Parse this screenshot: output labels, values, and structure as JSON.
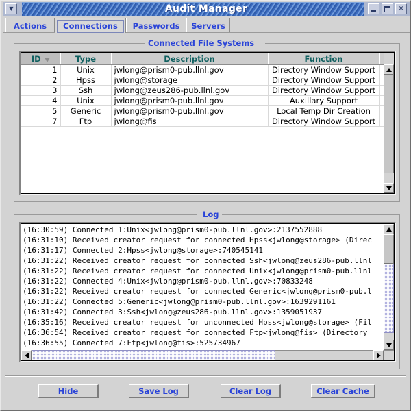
{
  "window": {
    "title": "Audit Manager",
    "menu_icon": "chevron-down-icon",
    "minimize_label": "–",
    "maximize_label": "□",
    "close_label": "✕"
  },
  "tabs": [
    {
      "label": "Actions",
      "selected": false
    },
    {
      "label": "Connections",
      "selected": true
    },
    {
      "label": "Passwords",
      "selected": false
    },
    {
      "label": "Servers",
      "selected": false
    }
  ],
  "connected_panel": {
    "title": "Connected File Systems",
    "columns": [
      "ID",
      "Type",
      "Description",
      "Function",
      ""
    ],
    "sort_column": "ID",
    "sort_direction": "descending",
    "rows": [
      {
        "id": "1",
        "type": "Unix",
        "description": "jwlong@prism0-pub.llnl.gov",
        "function": "Directory Window Support"
      },
      {
        "id": "2",
        "type": "Hpss",
        "description": "jwlong@storage",
        "function": "Directory Window Support"
      },
      {
        "id": "3",
        "type": "Ssh",
        "description": "jwlong@zeus286-pub.llnl.gov",
        "function": "Directory Window Support"
      },
      {
        "id": "4",
        "type": "Unix",
        "description": "jwlong@prism0-pub.llnl.gov",
        "function": "Auxillary Support"
      },
      {
        "id": "5",
        "type": "Generic",
        "description": "jwlong@prism0-pub.llnl.gov",
        "function": "Local Temp Dir Creation"
      },
      {
        "id": "7",
        "type": "Ftp",
        "description": "jwlong@fis",
        "function": "Directory Window Support"
      }
    ]
  },
  "log_panel": {
    "title": "Log",
    "lines": [
      "(16:30:59) Connected 1:Unix<jwlong@prism0-pub.llnl.gov>:2137552888",
      "(16:31:10) Received creator request for connected Hpss<jwlong@storage> (Direc",
      "(16:31:17) Connected 2:Hpss<jwlong@storage>:740545141",
      "(16:31:22) Received creator request for connected Ssh<jwlong@zeus286-pub.llnl",
      "(16:31:22) Received creator request for connected Unix<jwlong@prism0-pub.llnl",
      "(16:31:22) Connected 4:Unix<jwlong@prism0-pub.llnl.gov>:70833248",
      "(16:31:22) Received creator request for connected Generic<jwlong@prism0-pub.l",
      "(16:31:22) Connected 5:Generic<jwlong@prism0-pub.llnl.gov>:1639291161",
      "(16:31:42) Connected 3:Ssh<jwlong@zeus286-pub.llnl.gov>:1359051937",
      "(16:35:16) Received creator request for unconnected Hpss<jwlong@storage> (Fil",
      "(16:36:54) Received creator request for connected Ftp<jwlong@fis> (Directory ",
      "(16:36:55) Connected 7:Ftp<jwlong@fis>:525734967"
    ]
  },
  "buttons": [
    {
      "label": "Hide"
    },
    {
      "label": "Save Log"
    },
    {
      "label": "Clear Log"
    },
    {
      "label": "Clear Cache"
    }
  ],
  "colors": {
    "accent_blue": "#2a44d8",
    "header_teal": "#106060",
    "face": "#d3d3d3",
    "titlebar_blue": "#3b6bbf",
    "scroll_thumb": "#b3b3e0"
  }
}
